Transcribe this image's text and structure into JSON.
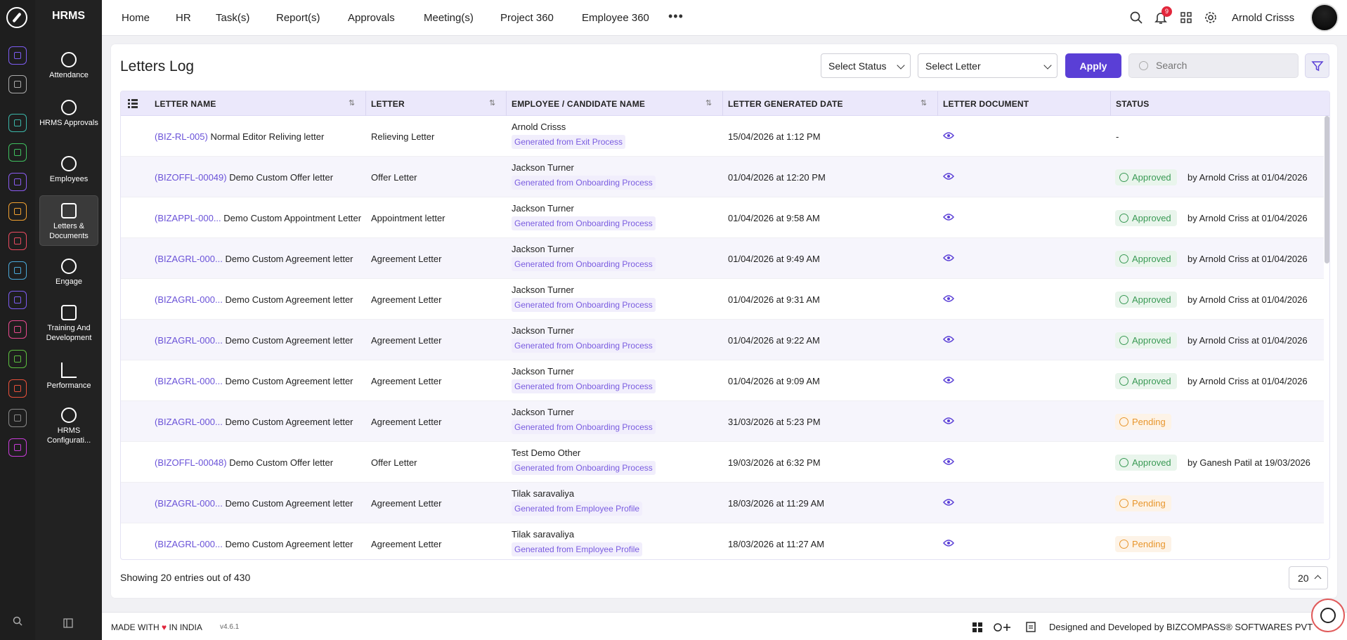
{
  "app": {
    "name": "HRMS",
    "nav": [
      "Home",
      "HR",
      "Task(s)",
      "Report(s)",
      "Approvals",
      "Meeting(s)",
      "Project 360",
      "Employee 360"
    ],
    "more_icon": "ellipsis-icon",
    "notification_count": "9",
    "user_name": "Arnold Crisss"
  },
  "sidebar": {
    "items": [
      {
        "label": "Attendance",
        "icon": "clock-calendar-icon"
      },
      {
        "label": "HRMS Approvals",
        "icon": "approval-icon"
      },
      {
        "label": "Employees",
        "icon": "person-icon"
      },
      {
        "label": "Letters & Documents",
        "icon": "letters-icon"
      },
      {
        "label": "Engage",
        "icon": "heart-hand-icon"
      },
      {
        "label": "Training And Development",
        "icon": "presentation-icon"
      },
      {
        "label": "Performance",
        "icon": "chart-line-icon"
      },
      {
        "label": "HRMS Configurati...",
        "icon": "gear-icon"
      }
    ]
  },
  "rail_colors": [
    "#7c5cf0",
    "#aaaaaa",
    "#3bb6a8",
    "#3fbf5f",
    "#8a5cf0",
    "#f0a030",
    "#e84a5f",
    "#4aa8d8",
    "#7c5cf0",
    "#e84a8f",
    "#5cbf3f",
    "#e8503a",
    "#888888",
    "#c83cd8"
  ],
  "page": {
    "title": "Letters Log",
    "status_placeholder": "Select Status",
    "letter_placeholder": "Select Letter",
    "apply_label": "Apply",
    "search_placeholder": "Search"
  },
  "table": {
    "headers": [
      "LETTER NAME",
      "LETTER",
      "EMPLOYEE / CANDIDATE NAME",
      "LETTER GENERATED DATE",
      "LETTER DOCUMENT",
      "STATUS"
    ],
    "rows": [
      {
        "code": "(BIZ-RL-005)",
        "name": "Normal Editor Reliving letter",
        "letter": "Relieving Letter",
        "person": "Arnold Crisss",
        "source": "Generated from Exit Process",
        "date": "15/04/2026 at 1:12 PM",
        "status": "",
        "status_text": "-",
        "by": ""
      },
      {
        "code": "(BIZOFFL-00049)",
        "name": "Demo Custom Offer letter",
        "letter": "Offer Letter",
        "person": "Jackson Turner",
        "source": "Generated from Onboarding Process",
        "date": "01/04/2026 at 12:20 PM",
        "status": "approved",
        "status_text": "Approved",
        "by": "by Arnold Criss at 01/04/2026"
      },
      {
        "code": "(BIZAPPL-000...",
        "name": "Demo Custom Appointment Letter",
        "letter": "Appointment letter",
        "person": "Jackson Turner",
        "source": "Generated from Onboarding Process",
        "date": "01/04/2026 at 9:58 AM",
        "status": "approved",
        "status_text": "Approved",
        "by": "by Arnold Criss at 01/04/2026"
      },
      {
        "code": "(BIZAGRL-000...",
        "name": "Demo Custom Agreement letter",
        "letter": "Agreement Letter",
        "person": "Jackson Turner",
        "source": "Generated from Onboarding Process",
        "date": "01/04/2026 at 9:49 AM",
        "status": "approved",
        "status_text": "Approved",
        "by": "by Arnold Criss at 01/04/2026"
      },
      {
        "code": "(BIZAGRL-000...",
        "name": "Demo Custom Agreement letter",
        "letter": "Agreement Letter",
        "person": "Jackson Turner",
        "source": "Generated from Onboarding Process",
        "date": "01/04/2026 at 9:31 AM",
        "status": "approved",
        "status_text": "Approved",
        "by": "by Arnold Criss at 01/04/2026"
      },
      {
        "code": "(BIZAGRL-000...",
        "name": "Demo Custom Agreement letter",
        "letter": "Agreement Letter",
        "person": "Jackson Turner",
        "source": "Generated from Onboarding Process",
        "date": "01/04/2026 at 9:22 AM",
        "status": "approved",
        "status_text": "Approved",
        "by": "by Arnold Criss at 01/04/2026"
      },
      {
        "code": "(BIZAGRL-000...",
        "name": "Demo Custom Agreement letter",
        "letter": "Agreement Letter",
        "person": "Jackson Turner",
        "source": "Generated from Onboarding Process",
        "date": "01/04/2026 at 9:09 AM",
        "status": "approved",
        "status_text": "Approved",
        "by": "by Arnold Criss at 01/04/2026"
      },
      {
        "code": "(BIZAGRL-000...",
        "name": "Demo Custom Agreement letter",
        "letter": "Agreement Letter",
        "person": "Jackson Turner",
        "source": "Generated from Onboarding Process",
        "date": "31/03/2026 at 5:23 PM",
        "status": "pending",
        "status_text": "Pending",
        "by": ""
      },
      {
        "code": "(BIZOFFL-00048)",
        "name": "Demo Custom Offer letter",
        "letter": "Offer Letter",
        "person": "Test Demo Other",
        "source": "Generated from Onboarding Process",
        "date": "19/03/2026 at 6:32 PM",
        "status": "approved",
        "status_text": "Approved",
        "by": "by Ganesh Patil at 19/03/2026"
      },
      {
        "code": "(BIZAGRL-000...",
        "name": "Demo Custom Agreement letter",
        "letter": "Agreement Letter",
        "person": "Tilak saravaliya",
        "source": "Generated from Employee Profile",
        "date": "18/03/2026 at 11:29 AM",
        "status": "pending",
        "status_text": "Pending",
        "by": ""
      },
      {
        "code": "(BIZAGRL-000...",
        "name": "Demo Custom Agreement letter",
        "letter": "Agreement Letter",
        "person": "Tilak saravaliya",
        "source": "Generated from Employee Profile",
        "date": "18/03/2026 at 11:27 AM",
        "status": "pending",
        "status_text": "Pending",
        "by": ""
      }
    ]
  },
  "footer": {
    "showing": "Showing 20 entries out of 430",
    "page_size": "20"
  },
  "bottombar": {
    "made_prefix": "MADE WITH",
    "made_suffix": "IN INDIA",
    "version": "v4.6.1",
    "designed": "Designed and Developed by  BIZCOMPASS® SOFTWARES PVT"
  },
  "colors": {
    "accent": "#5a3fd6",
    "approved": "#3a9a55",
    "pending": "#e8962d"
  }
}
